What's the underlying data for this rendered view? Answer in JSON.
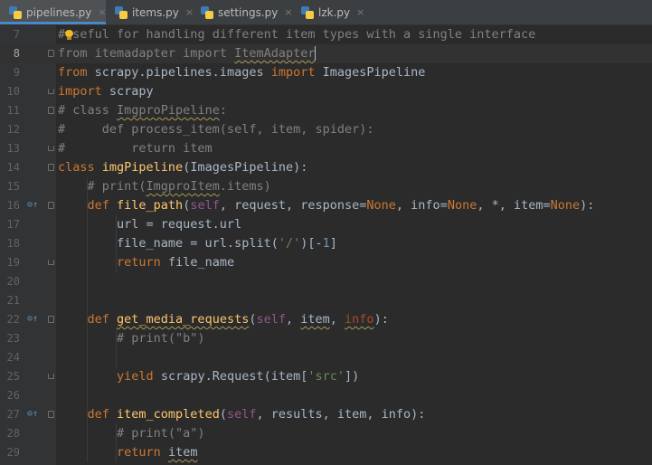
{
  "tabs": [
    {
      "label": "pipelines.py",
      "active": true,
      "icon": "python-file-icon"
    },
    {
      "label": "items.py",
      "active": false,
      "icon": "python-file-icon"
    },
    {
      "label": "settings.py",
      "active": false,
      "icon": "python-file-icon"
    },
    {
      "label": "lzk.py",
      "active": false,
      "icon": "python-file-icon"
    }
  ],
  "close_glyph": "×",
  "current_line": 8,
  "lines": [
    {
      "num": "7",
      "segs": [
        [
          "#",
          "cm"
        ],
        [
          "useful for handling different item types with a single interface",
          "cm"
        ]
      ]
    },
    {
      "num": "8",
      "segs": [
        [
          "from itemadapter import ",
          "dim"
        ],
        [
          "ItemAdapter",
          "dim squig"
        ]
      ]
    },
    {
      "num": "9",
      "segs": [
        [
          "from ",
          "kw"
        ],
        [
          "scrapy.pipelines.images ",
          ""
        ],
        [
          "import ",
          "kw"
        ],
        [
          "ImagesPipeline",
          ""
        ]
      ]
    },
    {
      "num": "10",
      "segs": [
        [
          "import ",
          "kw"
        ],
        [
          "scrapy",
          ""
        ]
      ]
    },
    {
      "num": "11",
      "segs": [
        [
          "# class ",
          "cm"
        ],
        [
          "ImgproPipeline",
          "cm squig"
        ],
        [
          ":",
          "cm"
        ]
      ]
    },
    {
      "num": "12",
      "segs": [
        [
          "#     def process_item(self, item, spider):",
          "cm"
        ]
      ]
    },
    {
      "num": "13",
      "segs": [
        [
          "#         return item",
          "cm"
        ]
      ]
    },
    {
      "num": "14",
      "segs": [
        [
          "class ",
          "kw"
        ],
        [
          "imgPipeline",
          "fn"
        ],
        [
          "(ImagesPipeline):",
          ""
        ]
      ]
    },
    {
      "num": "15",
      "segs": [
        [
          "    # print(",
          "cm"
        ],
        [
          "ImgproItem",
          "cm squig"
        ],
        [
          ".items)",
          "cm"
        ]
      ]
    },
    {
      "num": "16",
      "segs": [
        [
          "    ",
          ""
        ],
        [
          "def ",
          "kw"
        ],
        [
          "file_path",
          "fn"
        ],
        [
          "(",
          ""
        ],
        [
          "self",
          "sl"
        ],
        [
          ", request, response=",
          ""
        ],
        [
          "None",
          "kw"
        ],
        [
          ", info=",
          ""
        ],
        [
          "None",
          "kw"
        ],
        [
          ", *, item=",
          ""
        ],
        [
          "None",
          "kw"
        ],
        [
          "):",
          ""
        ]
      ]
    },
    {
      "num": "17",
      "segs": [
        [
          "        url = request.url",
          ""
        ]
      ]
    },
    {
      "num": "18",
      "segs": [
        [
          "        file_name = url.split(",
          ""
        ],
        [
          "'/'",
          "st"
        ],
        [
          ")[-",
          ""
        ],
        [
          "1",
          "nm"
        ],
        [
          "]",
          ""
        ]
      ]
    },
    {
      "num": "19",
      "segs": [
        [
          "        ",
          ""
        ],
        [
          "return ",
          "kw"
        ],
        [
          "file_name",
          ""
        ]
      ]
    },
    {
      "num": "20",
      "segs": []
    },
    {
      "num": "21",
      "segs": []
    },
    {
      "num": "22",
      "segs": [
        [
          "    ",
          ""
        ],
        [
          "def ",
          "kw"
        ],
        [
          "get_media_requests",
          "fn squig"
        ],
        [
          "(",
          ""
        ],
        [
          "self",
          "sl"
        ],
        [
          ", ",
          ""
        ],
        [
          "item",
          "squig"
        ],
        [
          ", ",
          ""
        ],
        [
          "info",
          "pm squig"
        ],
        [
          "):",
          ""
        ]
      ]
    },
    {
      "num": "23",
      "segs": [
        [
          "        # print(\"b\")",
          "cm"
        ]
      ]
    },
    {
      "num": "24",
      "segs": []
    },
    {
      "num": "25",
      "segs": [
        [
          "        ",
          ""
        ],
        [
          "yield ",
          "kw"
        ],
        [
          "scrapy.Request(item[",
          ""
        ],
        [
          "'src'",
          "st"
        ],
        [
          "])",
          ""
        ]
      ]
    },
    {
      "num": "26",
      "segs": []
    },
    {
      "num": "27",
      "segs": [
        [
          "    ",
          ""
        ],
        [
          "def ",
          "kw"
        ],
        [
          "item_completed",
          "fn"
        ],
        [
          "(",
          ""
        ],
        [
          "self",
          "sl"
        ],
        [
          ", results, item, info):",
          ""
        ]
      ]
    },
    {
      "num": "28",
      "segs": [
        [
          "        # print(\"a\")",
          "cm"
        ]
      ]
    },
    {
      "num": "29",
      "segs": [
        [
          "        ",
          ""
        ],
        [
          "return ",
          "kw"
        ],
        [
          "item",
          "squig"
        ]
      ]
    }
  ],
  "override_marks": {
    "16": "⊙↑",
    "22": "⊙↑",
    "27": "⊙↑"
  },
  "intention_bulb_line": 7,
  "colors": {
    "keyword": "#cc7832",
    "function": "#ffc66d",
    "comment": "#808080",
    "string": "#6a8759",
    "number": "#6897bb",
    "self": "#94558d"
  }
}
